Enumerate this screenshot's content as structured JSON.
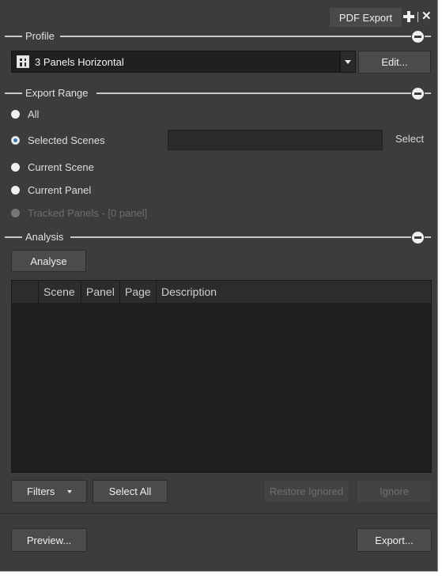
{
  "window": {
    "tab_label": "PDF Export"
  },
  "profile": {
    "section_label": "Profile",
    "selected": "3 Panels Horizontal",
    "edit_button": "Edit..."
  },
  "export_range": {
    "section_label": "Export Range",
    "options": [
      {
        "label": "All",
        "checked": false,
        "enabled": true
      },
      {
        "label": "Selected Scenes",
        "checked": true,
        "enabled": true
      },
      {
        "label": "Current Scene",
        "checked": false,
        "enabled": true
      },
      {
        "label": "Current Panel",
        "checked": false,
        "enabled": true
      },
      {
        "label": "Tracked Panels - [0 panel]",
        "checked": false,
        "enabled": false
      }
    ],
    "select_link": "Select"
  },
  "analysis": {
    "section_label": "Analysis",
    "analyse_button": "Analyse",
    "columns": [
      "",
      "Scene",
      "Panel",
      "Page",
      "Description"
    ]
  },
  "toolbar": {
    "filters": "Filters",
    "select_all": "Select All",
    "restore_ignored": "Restore Ignored",
    "ignore": "Ignore"
  },
  "footer": {
    "preview": "Preview...",
    "export": "Export..."
  },
  "colors": {
    "panel_bg": "#3c3c3c",
    "accent": "#3b78b8"
  }
}
